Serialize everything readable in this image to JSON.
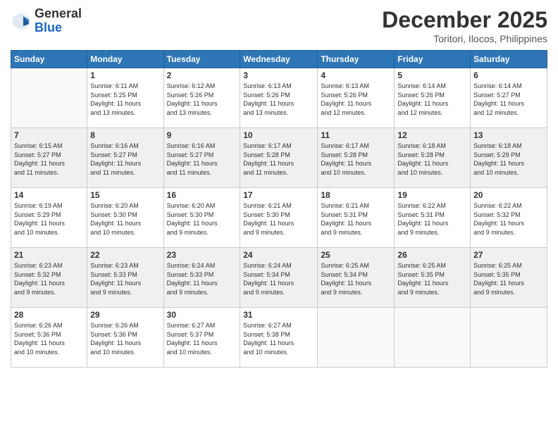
{
  "header": {
    "logo_general": "General",
    "logo_blue": "Blue",
    "month": "December 2025",
    "location": "Toritori, Ilocos, Philippines"
  },
  "days_of_week": [
    "Sunday",
    "Monday",
    "Tuesday",
    "Wednesday",
    "Thursday",
    "Friday",
    "Saturday"
  ],
  "weeks": [
    [
      {
        "day": "",
        "info": ""
      },
      {
        "day": "1",
        "info": "Sunrise: 6:11 AM\nSunset: 5:25 PM\nDaylight: 11 hours\nand 13 minutes."
      },
      {
        "day": "2",
        "info": "Sunrise: 6:12 AM\nSunset: 5:26 PM\nDaylight: 11 hours\nand 13 minutes."
      },
      {
        "day": "3",
        "info": "Sunrise: 6:13 AM\nSunset: 5:26 PM\nDaylight: 11 hours\nand 13 minutes."
      },
      {
        "day": "4",
        "info": "Sunrise: 6:13 AM\nSunset: 5:26 PM\nDaylight: 11 hours\nand 12 minutes."
      },
      {
        "day": "5",
        "info": "Sunrise: 6:14 AM\nSunset: 5:26 PM\nDaylight: 11 hours\nand 12 minutes."
      },
      {
        "day": "6",
        "info": "Sunrise: 6:14 AM\nSunset: 5:27 PM\nDaylight: 11 hours\nand 12 minutes."
      }
    ],
    [
      {
        "day": "7",
        "info": "Sunrise: 6:15 AM\nSunset: 5:27 PM\nDaylight: 11 hours\nand 11 minutes."
      },
      {
        "day": "8",
        "info": "Sunrise: 6:16 AM\nSunset: 5:27 PM\nDaylight: 11 hours\nand 11 minutes."
      },
      {
        "day": "9",
        "info": "Sunrise: 6:16 AM\nSunset: 5:27 PM\nDaylight: 11 hours\nand 11 minutes."
      },
      {
        "day": "10",
        "info": "Sunrise: 6:17 AM\nSunset: 5:28 PM\nDaylight: 11 hours\nand 11 minutes."
      },
      {
        "day": "11",
        "info": "Sunrise: 6:17 AM\nSunset: 5:28 PM\nDaylight: 11 hours\nand 10 minutes."
      },
      {
        "day": "12",
        "info": "Sunrise: 6:18 AM\nSunset: 5:28 PM\nDaylight: 11 hours\nand 10 minutes."
      },
      {
        "day": "13",
        "info": "Sunrise: 6:18 AM\nSunset: 5:29 PM\nDaylight: 11 hours\nand 10 minutes."
      }
    ],
    [
      {
        "day": "14",
        "info": "Sunrise: 6:19 AM\nSunset: 5:29 PM\nDaylight: 11 hours\nand 10 minutes."
      },
      {
        "day": "15",
        "info": "Sunrise: 6:20 AM\nSunset: 5:30 PM\nDaylight: 11 hours\nand 10 minutes."
      },
      {
        "day": "16",
        "info": "Sunrise: 6:20 AM\nSunset: 5:30 PM\nDaylight: 11 hours\nand 9 minutes."
      },
      {
        "day": "17",
        "info": "Sunrise: 6:21 AM\nSunset: 5:30 PM\nDaylight: 11 hours\nand 9 minutes."
      },
      {
        "day": "18",
        "info": "Sunrise: 6:21 AM\nSunset: 5:31 PM\nDaylight: 11 hours\nand 9 minutes."
      },
      {
        "day": "19",
        "info": "Sunrise: 6:22 AM\nSunset: 5:31 PM\nDaylight: 11 hours\nand 9 minutes."
      },
      {
        "day": "20",
        "info": "Sunrise: 6:22 AM\nSunset: 5:32 PM\nDaylight: 11 hours\nand 9 minutes."
      }
    ],
    [
      {
        "day": "21",
        "info": "Sunrise: 6:23 AM\nSunset: 5:32 PM\nDaylight: 11 hours\nand 9 minutes."
      },
      {
        "day": "22",
        "info": "Sunrise: 6:23 AM\nSunset: 5:33 PM\nDaylight: 11 hours\nand 9 minutes."
      },
      {
        "day": "23",
        "info": "Sunrise: 6:24 AM\nSunset: 5:33 PM\nDaylight: 11 hours\nand 9 minutes."
      },
      {
        "day": "24",
        "info": "Sunrise: 6:24 AM\nSunset: 5:34 PM\nDaylight: 11 hours\nand 9 minutes."
      },
      {
        "day": "25",
        "info": "Sunrise: 6:25 AM\nSunset: 5:34 PM\nDaylight: 11 hours\nand 9 minutes."
      },
      {
        "day": "26",
        "info": "Sunrise: 6:25 AM\nSunset: 5:35 PM\nDaylight: 11 hours\nand 9 minutes."
      },
      {
        "day": "27",
        "info": "Sunrise: 6:25 AM\nSunset: 5:35 PM\nDaylight: 11 hours\nand 9 minutes."
      }
    ],
    [
      {
        "day": "28",
        "info": "Sunrise: 6:26 AM\nSunset: 5:36 PM\nDaylight: 11 hours\nand 10 minutes."
      },
      {
        "day": "29",
        "info": "Sunrise: 6:26 AM\nSunset: 5:36 PM\nDaylight: 11 hours\nand 10 minutes."
      },
      {
        "day": "30",
        "info": "Sunrise: 6:27 AM\nSunset: 5:37 PM\nDaylight: 11 hours\nand 10 minutes."
      },
      {
        "day": "31",
        "info": "Sunrise: 6:27 AM\nSunset: 5:38 PM\nDaylight: 11 hours\nand 10 minutes."
      },
      {
        "day": "",
        "info": ""
      },
      {
        "day": "",
        "info": ""
      },
      {
        "day": "",
        "info": ""
      }
    ]
  ]
}
